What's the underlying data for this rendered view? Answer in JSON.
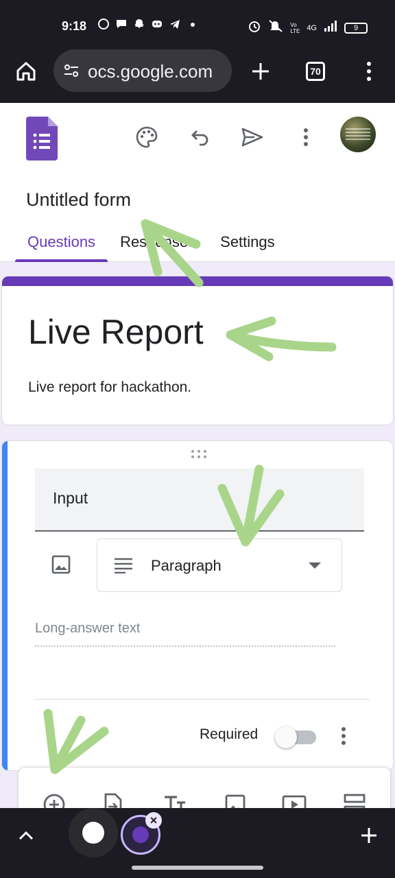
{
  "status_bar": {
    "time": "9:18",
    "network": "4G",
    "network_sub": "Vo LTE",
    "battery": "9",
    "notification_icons": [
      "whatsapp-icon",
      "chat-icon",
      "snapchat-icon",
      "discord-icon",
      "telegram-icon",
      "dot-icon"
    ]
  },
  "browser": {
    "url": "ocs.google.com",
    "tab_count": "70"
  },
  "form": {
    "doc_title": "Untitled form",
    "tabs": [
      {
        "label": "Questions",
        "active": true
      },
      {
        "label": "Responses",
        "active": false
      },
      {
        "label": "Settings",
        "active": false
      }
    ],
    "title": "Live Report",
    "description": "Live report for hackathon.",
    "question": {
      "title": "Input",
      "type": "Paragraph",
      "placeholder": "Long-answer text",
      "required_label": "Required",
      "required": false
    }
  },
  "toolbar_icons": [
    "add-question-icon",
    "import-questions-icon",
    "add-title-icon",
    "add-image-icon",
    "add-video-icon",
    "add-section-icon"
  ],
  "colors": {
    "forms_purple": "#673ab7",
    "question_accent": "#4285f4",
    "annotation_green": "#a9d58a"
  }
}
